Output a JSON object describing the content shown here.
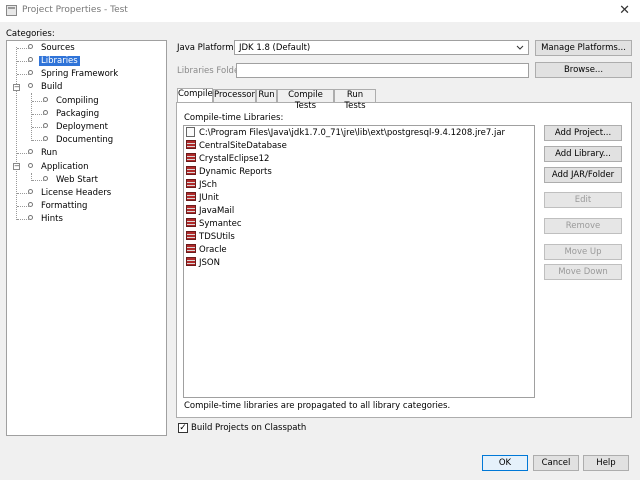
{
  "window": {
    "title": "Project Properties - Test",
    "close_glyph": "✕"
  },
  "categories": {
    "label": "Categories:",
    "items": [
      {
        "label": "Sources"
      },
      {
        "label": "Libraries"
      },
      {
        "label": "Spring Framework"
      },
      {
        "label": "Build"
      },
      {
        "label": "Compiling"
      },
      {
        "label": "Packaging"
      },
      {
        "label": "Deployment"
      },
      {
        "label": "Documenting"
      },
      {
        "label": "Run"
      },
      {
        "label": "Application"
      },
      {
        "label": "Web Start"
      },
      {
        "label": "License Headers"
      },
      {
        "label": "Formatting"
      },
      {
        "label": "Hints"
      }
    ],
    "selected": "Libraries"
  },
  "platform": {
    "label": "Java Platform:",
    "value": "JDK 1.8 (Default)",
    "manage_button": "Manage Platforms..."
  },
  "libraries_folder": {
    "label": "Libraries Folder:",
    "browse_button": "Browse..."
  },
  "tabs": [
    {
      "label": "Compile"
    },
    {
      "label": "Processor"
    },
    {
      "label": "Run"
    },
    {
      "label": "Compile Tests"
    },
    {
      "label": "Run Tests"
    }
  ],
  "active_tab": "Compile",
  "compile": {
    "list_label": "Compile-time Libraries:",
    "libraries": [
      {
        "name": "C:\\Program Files\\Java\\jdk1.7.0_71\\jre\\lib\\ext\\postgresql-9.4.1208.jre7.jar",
        "icon": "jar-icon"
      },
      {
        "name": "CentralSiteDatabase",
        "icon": "library-icon"
      },
      {
        "name": "CrystalEclipse12",
        "icon": "library-icon"
      },
      {
        "name": "Dynamic Reports",
        "icon": "library-icon"
      },
      {
        "name": "JSch",
        "icon": "library-icon"
      },
      {
        "name": "JUnit",
        "icon": "library-icon"
      },
      {
        "name": "JavaMail",
        "icon": "library-icon"
      },
      {
        "name": "Symantec",
        "icon": "library-icon"
      },
      {
        "name": "TDSUtils",
        "icon": "library-icon"
      },
      {
        "name": "Oracle",
        "icon": "library-icon"
      },
      {
        "name": "JSON",
        "icon": "library-icon"
      }
    ],
    "buttons": {
      "add_project": "Add Project...",
      "add_library": "Add Library...",
      "add_jar": "Add JAR/Folder",
      "edit": "Edit",
      "remove": "Remove",
      "move_up": "Move Up",
      "move_down": "Move Down"
    },
    "note": "Compile-time libraries are propagated to all library categories."
  },
  "build_on_classpath": {
    "label": "Build Projects on Classpath",
    "checked": true,
    "check_glyph": "✓"
  },
  "footer": {
    "ok": "OK",
    "cancel": "Cancel",
    "help": "Help"
  }
}
